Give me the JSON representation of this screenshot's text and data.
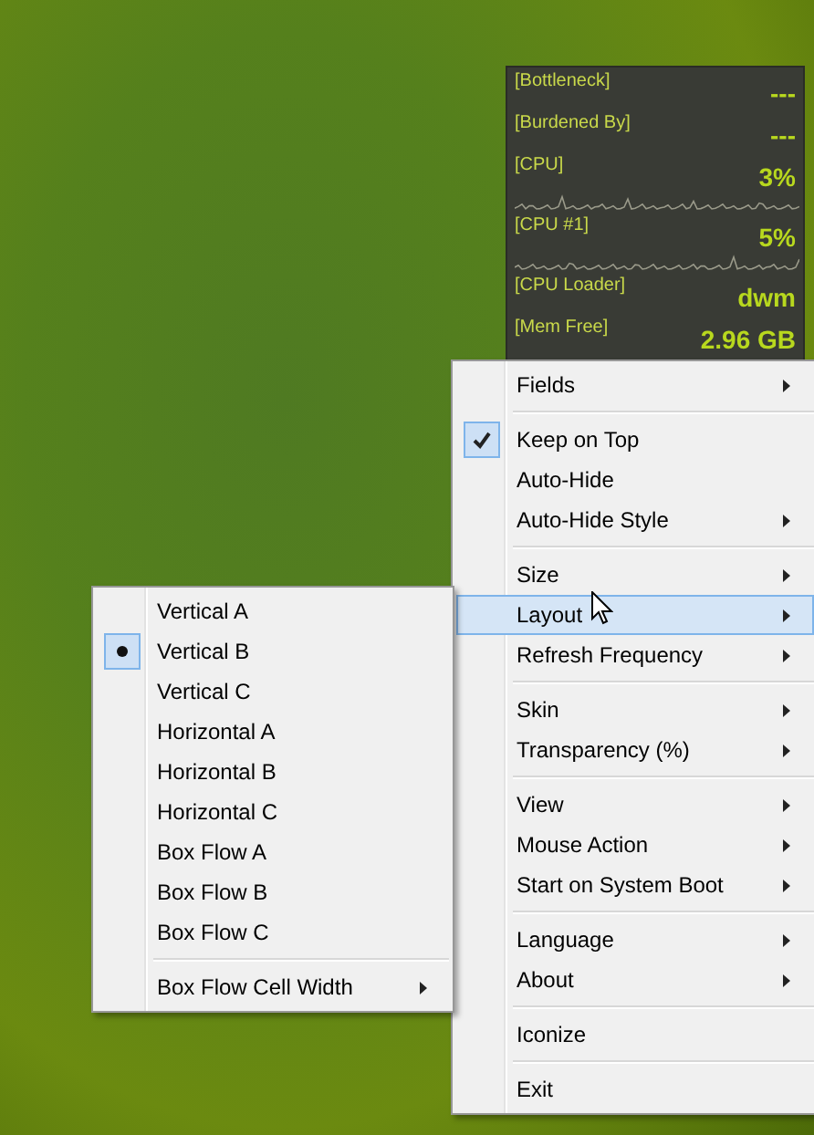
{
  "widget": {
    "rows": [
      {
        "label": "[Bottleneck]",
        "value": "---",
        "sparkline": false
      },
      {
        "label": "[Burdened By]",
        "value": "---",
        "sparkline": false
      },
      {
        "label": "[CPU]",
        "value": "3%",
        "sparkline": true
      },
      {
        "label": "[CPU #1]",
        "value": "5%",
        "sparkline": true
      },
      {
        "label": "[CPU Loader]",
        "value": "dwm",
        "sparkline": false
      },
      {
        "label": "[Mem Free]",
        "value": "2.96 GB",
        "sparkline": false
      }
    ]
  },
  "context_menu": {
    "groups": [
      [
        {
          "label": "Fields",
          "submenu": true,
          "checked": false,
          "selected": false
        }
      ],
      [
        {
          "label": "Keep on Top",
          "submenu": false,
          "checked": true,
          "selected": false
        },
        {
          "label": "Auto-Hide",
          "submenu": false,
          "checked": false,
          "selected": false
        },
        {
          "label": "Auto-Hide Style",
          "submenu": true,
          "checked": false,
          "selected": false
        }
      ],
      [
        {
          "label": "Size",
          "submenu": true,
          "checked": false,
          "selected": false
        },
        {
          "label": "Layout",
          "submenu": true,
          "checked": false,
          "selected": true
        },
        {
          "label": "Refresh Frequency",
          "submenu": true,
          "checked": false,
          "selected": false
        }
      ],
      [
        {
          "label": "Skin",
          "submenu": true,
          "checked": false,
          "selected": false
        },
        {
          "label": "Transparency (%)",
          "submenu": true,
          "checked": false,
          "selected": false
        }
      ],
      [
        {
          "label": "View",
          "submenu": true,
          "checked": false,
          "selected": false
        },
        {
          "label": "Mouse Action",
          "submenu": true,
          "checked": false,
          "selected": false
        },
        {
          "label": "Start on System Boot",
          "submenu": true,
          "checked": false,
          "selected": false
        }
      ],
      [
        {
          "label": "Language",
          "submenu": true,
          "checked": false,
          "selected": false
        },
        {
          "label": "About",
          "submenu": true,
          "checked": false,
          "selected": false
        }
      ],
      [
        {
          "label": "Iconize",
          "submenu": false,
          "checked": false,
          "selected": false
        }
      ],
      [
        {
          "label": "Exit",
          "submenu": false,
          "checked": false,
          "selected": false
        }
      ]
    ]
  },
  "layout_submenu": {
    "groups": [
      [
        {
          "label": "Vertical A",
          "submenu": false,
          "checked": false,
          "selected": false
        },
        {
          "label": "Vertical B",
          "submenu": false,
          "checked": true,
          "selected": false
        },
        {
          "label": "Vertical C",
          "submenu": false,
          "checked": false,
          "selected": false
        },
        {
          "label": "Horizontal A",
          "submenu": false,
          "checked": false,
          "selected": false
        },
        {
          "label": "Horizontal B",
          "submenu": false,
          "checked": false,
          "selected": false
        },
        {
          "label": "Horizontal C",
          "submenu": false,
          "checked": false,
          "selected": false
        },
        {
          "label": "Box Flow A",
          "submenu": false,
          "checked": false,
          "selected": false
        },
        {
          "label": "Box Flow B",
          "submenu": false,
          "checked": false,
          "selected": false
        },
        {
          "label": "Box Flow C",
          "submenu": false,
          "checked": false,
          "selected": false
        }
      ],
      [
        {
          "label": "Box Flow Cell Width",
          "submenu": true,
          "checked": false,
          "selected": false
        }
      ]
    ]
  }
}
